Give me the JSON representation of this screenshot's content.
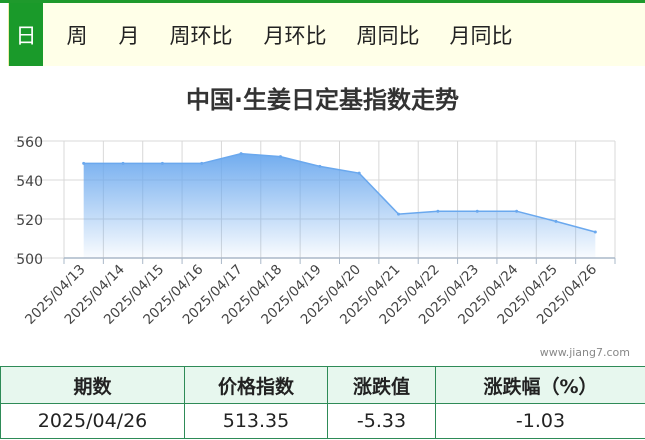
{
  "tabs": [
    {
      "label": "日",
      "active": true
    },
    {
      "label": "周",
      "active": false
    },
    {
      "label": "月",
      "active": false
    },
    {
      "label": "周环比",
      "active": false
    },
    {
      "label": "月环比",
      "active": false
    },
    {
      "label": "周同比",
      "active": false
    },
    {
      "label": "月同比",
      "active": false
    }
  ],
  "watermark": "www.jiang7.com",
  "colors": {
    "accent": "#1a9a2a",
    "area_top": "#6aa8ee",
    "line": "#6aa8ee"
  },
  "chart_data": {
    "type": "area",
    "title": "中国·生姜日定基指数走势",
    "categories": [
      "2025/04/13",
      "2025/04/14",
      "2025/04/15",
      "2025/04/16",
      "2025/04/17",
      "2025/04/18",
      "2025/04/19",
      "2025/04/20",
      "2025/04/21",
      "2025/04/22",
      "2025/04/23",
      "2025/04/24",
      "2025/04/25",
      "2025/04/26"
    ],
    "series": [
      {
        "values": [
          548.5,
          548.5,
          548.5,
          548.5,
          553.5,
          552.0,
          547.0,
          543.5,
          522.5,
          524.0,
          524.0,
          524.0,
          518.8,
          513.35
        ]
      }
    ],
    "yticks": [
      500,
      520,
      540,
      560
    ],
    "ylim": [
      500,
      560
    ],
    "grid": true
  },
  "summary": {
    "headers": [
      "期数",
      "价格指数",
      "涨跌值",
      "涨跌幅（%）"
    ],
    "row": [
      "2025/04/26",
      "513.35",
      "-5.33",
      "-1.03"
    ]
  }
}
